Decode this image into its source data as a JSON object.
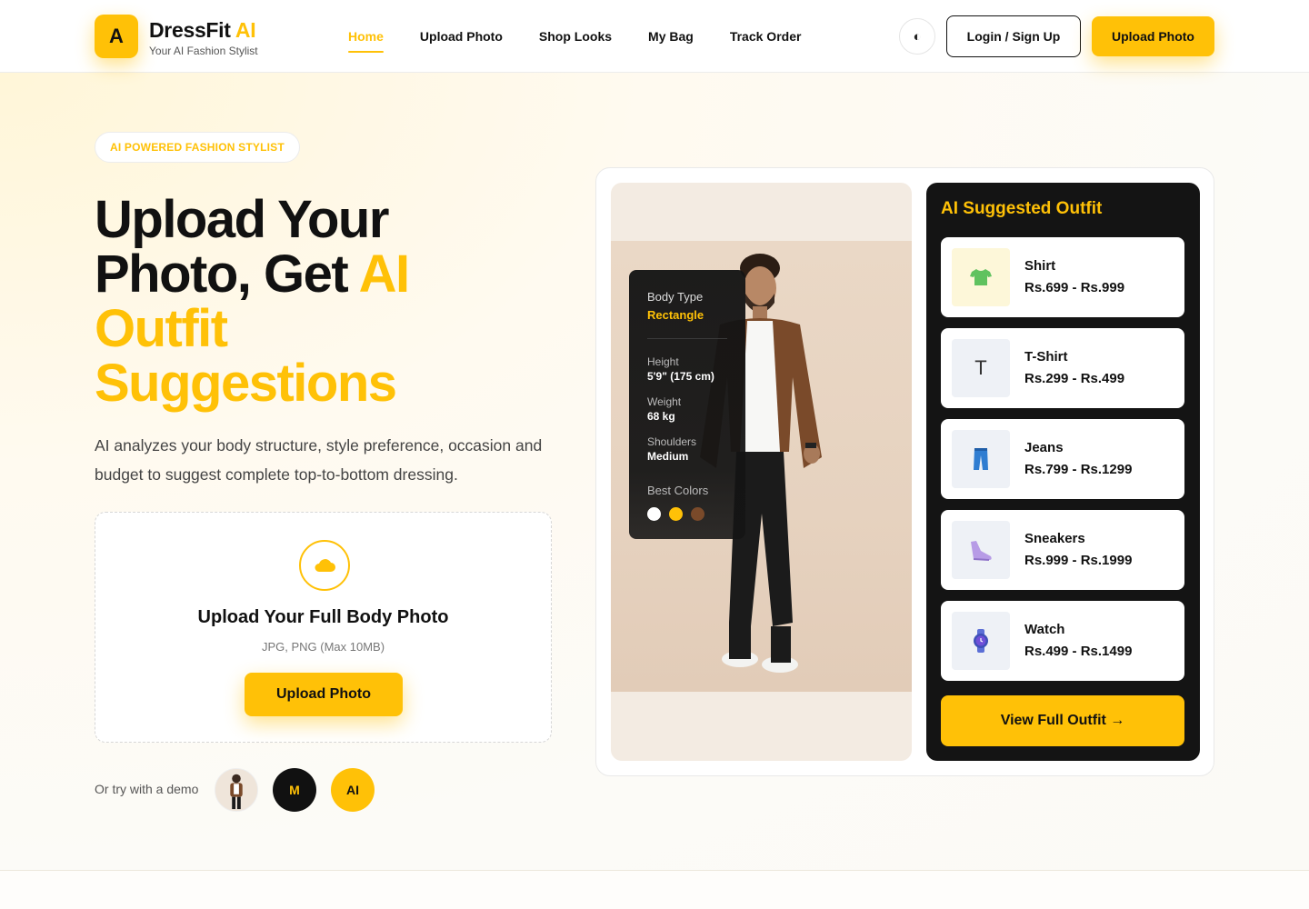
{
  "header": {
    "logo_letter": "A",
    "brand_name": "DressFit",
    "brand_accent": "AI",
    "tagline": "Your AI Fashion Stylist",
    "nav": [
      {
        "label": "Home",
        "active": true
      },
      {
        "label": "Upload Photo",
        "active": false
      },
      {
        "label": "Shop Looks",
        "active": false
      },
      {
        "label": "My Bag",
        "active": false
      },
      {
        "label": "Track Order",
        "active": false
      }
    ],
    "theme_icon": "◐",
    "login_label": "Login / Sign Up",
    "upload_label": "Upload Photo"
  },
  "hero": {
    "badge": "AI POWERED FASHION STYLIST",
    "title_line1": "Upload Your",
    "title_line2": "Photo, Get ",
    "title_accent1": "AI",
    "title_accent2": "Outfit",
    "title_accent3": "Suggestions",
    "description": "AI analyzes your body structure, style preference, occasion and budget to suggest complete top-to-bottom dressing."
  },
  "upload_card": {
    "icon": "cloud-icon",
    "title": "Upload Your Full Body Photo",
    "formats": "JPG, PNG (Max 10MB)",
    "button_label": "Upload Photo"
  },
  "demo": {
    "label": "Or try with a demo",
    "avatars": [
      "M",
      "AI"
    ]
  },
  "analysis": {
    "body_type_label": "Body Type",
    "body_type_value": "Rectangle",
    "height_label": "Height",
    "height_value": "5'9\" (175 cm)",
    "weight_label": "Weight",
    "weight_value": "68 kg",
    "shoulders_label": "Shoulders",
    "shoulders_value": "Medium",
    "best_colors_label": "Best Colors",
    "best_colors": [
      "#ffffff",
      "#ffc107",
      "#7a4a2a"
    ]
  },
  "suggestions": {
    "title": "AI Suggested Outfit",
    "items": [
      {
        "name": "Shirt",
        "price": "Rs.699 - Rs.999",
        "icon": "tshirt-icon"
      },
      {
        "name": "T-Shirt",
        "price": "Rs.299 - Rs.499",
        "icon": "T"
      },
      {
        "name": "Jeans",
        "price": "Rs.799 - Rs.1299",
        "icon": "jeans-icon"
      },
      {
        "name": "Sneakers",
        "price": "Rs.999 - Rs.1999",
        "icon": "sneaker-icon"
      },
      {
        "name": "Watch",
        "price": "Rs.499 - Rs.1499",
        "icon": "watch-icon"
      }
    ],
    "view_button": "View Full Outfit →"
  },
  "colors": {
    "accent": "#ffc107",
    "dark": "#141414",
    "text": "#111111"
  }
}
